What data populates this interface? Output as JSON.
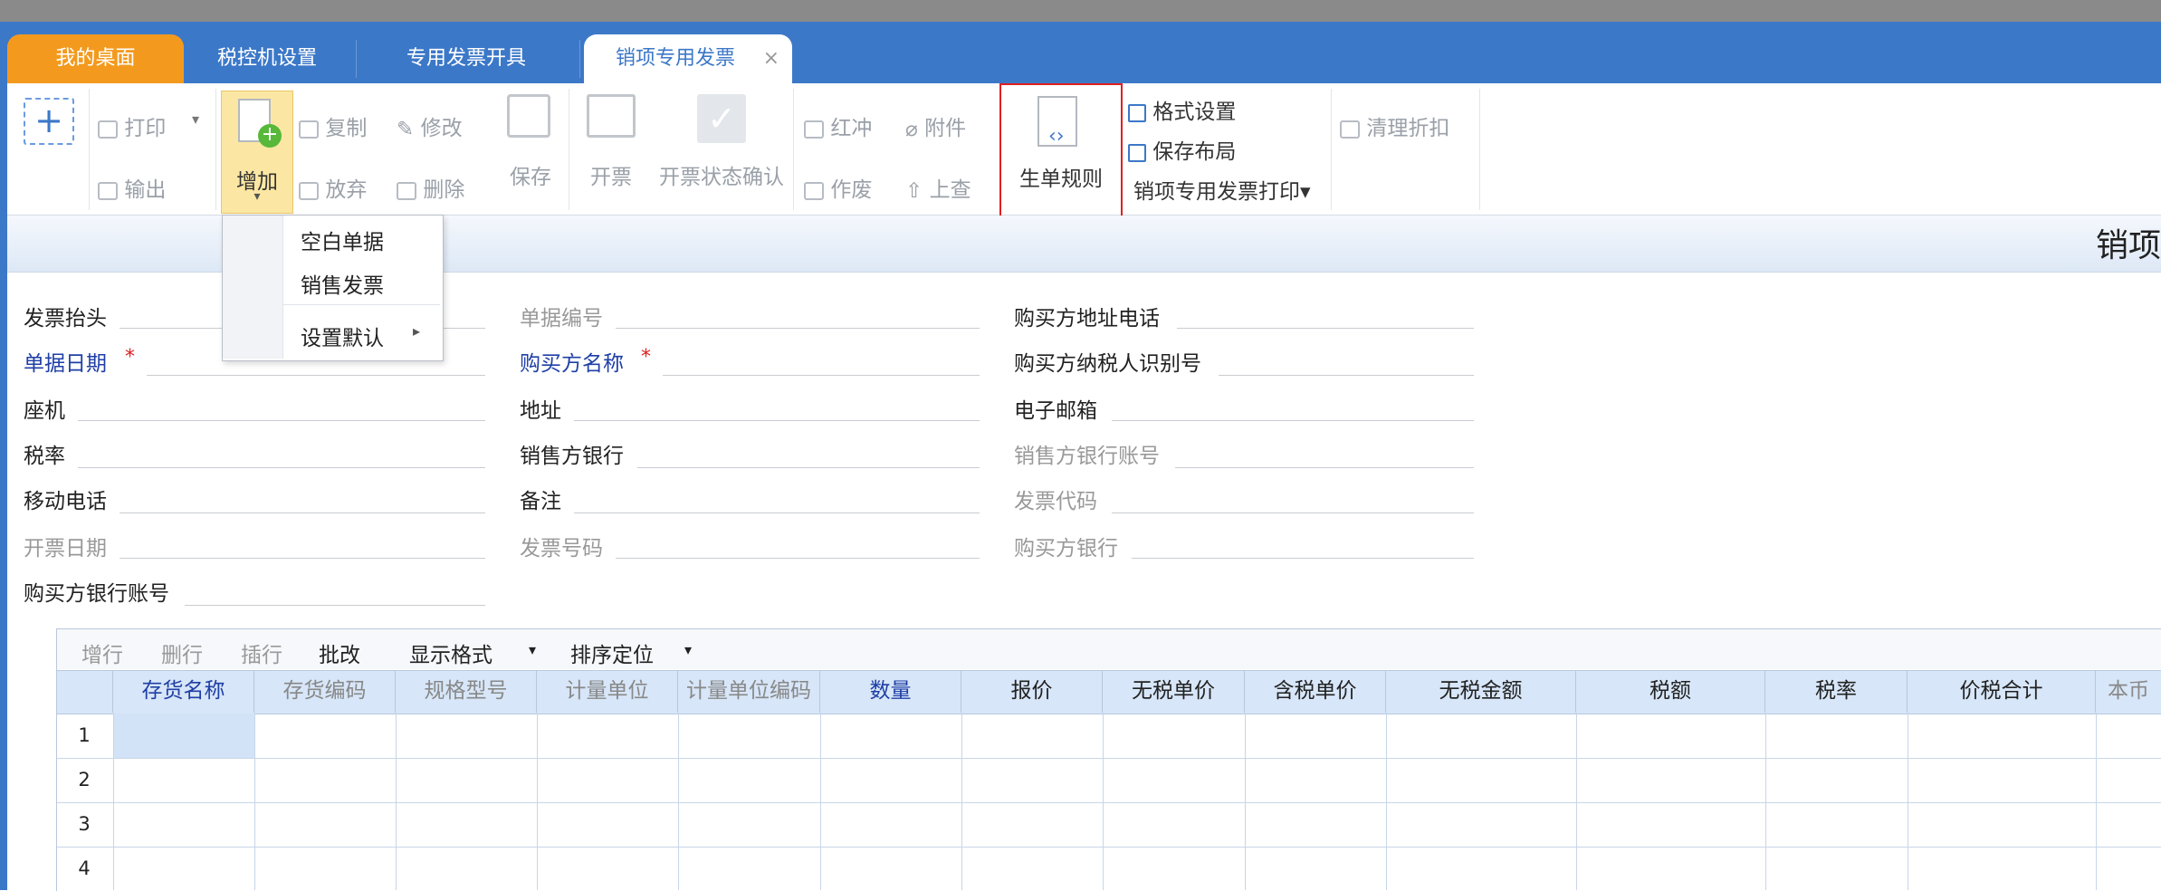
{
  "tabs": [
    {
      "label": "我的桌面"
    },
    {
      "label": "税控机设置"
    },
    {
      "label": "专用发票开具"
    },
    {
      "label": "销项专用发票",
      "close": "×"
    }
  ],
  "toolbar": {
    "new": "+",
    "print": "打印",
    "print_caret": "▾",
    "export": "输出",
    "add": "增加",
    "add_caret": "▾",
    "copy": "复制",
    "discard": "放弃",
    "edit": "修改",
    "delete": "删除",
    "save": "保存",
    "issue": "开票",
    "issue_confirm": "开票状态确认",
    "red_offset": "红冲",
    "void": "作废",
    "attach": "附件",
    "query_up": "上查",
    "gen_rule": "生单规则",
    "format_setting": "格式设置",
    "save_layout": "保存布局",
    "print_menu": "销项专用发票打印▾",
    "clear_discount": "清理折扣"
  },
  "dropdown": {
    "items": [
      "空白单据",
      "销售发票",
      "设置默认"
    ],
    "submenu_arrow": "▸"
  },
  "form_title": "销项",
  "form": {
    "invoice_header": "发票抬头",
    "doc_no": "单据编号",
    "buyer_addr_phone": "购买方地址电话",
    "doc_date": "单据日期",
    "buyer_name": "购买方名称",
    "buyer_tax_id": "购买方纳税人识别号",
    "landline": "座机",
    "address": "地址",
    "email": "电子邮箱",
    "tax_rate": "税率",
    "seller_bank": "销售方银行",
    "seller_bank_acct": "销售方银行账号",
    "mobile": "移动电话",
    "remark": "备注",
    "invoice_code": "发票代码",
    "issue_date": "开票日期",
    "invoice_no": "发票号码",
    "buyer_bank": "购买方银行",
    "buyer_bank_acct": "购买方银行账号",
    "required_mark": "*"
  },
  "grid_tools": {
    "add_row": "增行",
    "del_row": "删行",
    "insert_row": "插行",
    "batch_edit": "批改",
    "display_format": "显示格式",
    "sort_locate": "排序定位",
    "caret": "▾"
  },
  "grid": {
    "columns": [
      "存货名称",
      "存货编码",
      "规格型号",
      "计量单位",
      "计量单位编码",
      "数量",
      "报价",
      "无税单价",
      "含税单价",
      "无税金额",
      "税额",
      "税率",
      "价税合计",
      "本币"
    ],
    "rows": [
      "1",
      "2",
      "3",
      "4"
    ]
  },
  "colors": {
    "tab_bar": "#3c78c8",
    "active_desktop_tab": "#f39a1e",
    "highlight_box": "#e02020",
    "grid_header": "#d7e6f8"
  }
}
